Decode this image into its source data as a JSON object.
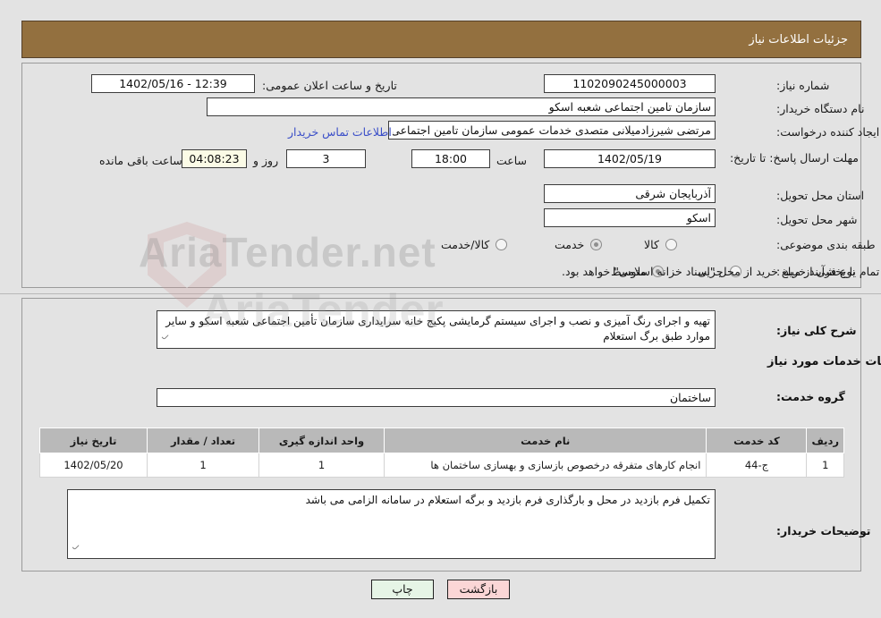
{
  "header": {
    "title": "جزئیات اطلاعات نیاز"
  },
  "watermark": {
    "text_main": "AriaTender.net",
    "text_secondary": "AriaTender"
  },
  "form": {
    "need_number": {
      "label": "شماره نیاز:",
      "value": "1102090245000003"
    },
    "announce_datetime": {
      "label": "تاریخ و ساعت اعلان عمومی:",
      "value": "1402/05/16 - 12:39"
    },
    "buyer_org": {
      "label": "نام دستگاه خریدار:",
      "value": "سازمان تامین اجتماعی شعبه اسکو"
    },
    "request_creator": {
      "label": "ایجاد کننده درخواست:",
      "value": "مرتضی شیرزادمیلانی متصدی خدمات عمومی سازمان تامین اجتماعی شعبه اسکو"
    },
    "buyer_contact_link": {
      "label": "اطلاعات تماس خریدار"
    },
    "deadline": {
      "label": "مهلت ارسال پاسخ: تا تاریخ:",
      "date": "1402/05/19",
      "hour_label": "ساعت",
      "hour": "18:00",
      "days": "3",
      "days_label": "روز و",
      "timer": "04:08:23",
      "timer_label": "ساعت باقی مانده"
    },
    "delivery_province": {
      "label": "استان محل تحویل:",
      "value": "آذربایجان شرقی"
    },
    "delivery_city": {
      "label": "شهر محل تحویل:",
      "value": "اسکو"
    },
    "subject_category": {
      "label": "طبقه بندی موضوعی:",
      "options": [
        "کالا",
        "خدمت",
        "کالا/خدمت"
      ],
      "selected": "خدمت"
    },
    "purchase_process": {
      "label": "نوع فرآیند خرید :",
      "options": [
        "جزیی",
        "متوسط"
      ],
      "selected": "متوسط",
      "treasury_checkbox_label": "پرداخت تمام یا بخشی از مبلغ خرید از محل \"اسناد خزانه اسلامی\" خواهد بود.",
      "treasury_checked": false
    }
  },
  "description": {
    "label": "شرح کلی نیاز:",
    "value": "تهیه و اجرای رنگ آمیزی و نصب و اجرای سیستم گرمایشی پکیج خانه سرایداری سازمان تأمین اجتماعی شعبه اسکو و سایر موارد طبق برگ استعلام"
  },
  "services_section": {
    "heading": "اطلاعات خدمات مورد نیاز",
    "service_group": {
      "label": "گروه خدمت:",
      "value": "ساختمان"
    },
    "table": {
      "columns": [
        "ردیف",
        "کد خدمت",
        "نام خدمت",
        "واحد اندازه گیری",
        "تعداد / مقدار",
        "تاریخ نیاز"
      ],
      "rows": [
        {
          "row_no": "1",
          "service_code": "ج-44",
          "service_name": "انجام کارهای متفرقه درخصوص بازسازی و بهسازی ساختمان ها",
          "unit": "1",
          "quantity": "1",
          "need_date": "1402/05/20"
        }
      ]
    }
  },
  "buyer_notes": {
    "label": "توضیحات خریدار:",
    "value": "تکمیل فرم بازدید در محل و بارگذاری فرم بازدید و برگه استعلام در سامانه الزامی می باشد"
  },
  "footer": {
    "print_label": "چاپ",
    "back_label": "بازگشت"
  },
  "colors": {
    "header_bg": "#93703f",
    "page_bg": "#e3e3e3",
    "table_header_bg": "#b9b9b9",
    "link": "#3a4ec8",
    "timer_bg": "#fbfbe6",
    "print_btn": "#e6f5e6",
    "back_btn": "#fbd6d6"
  }
}
